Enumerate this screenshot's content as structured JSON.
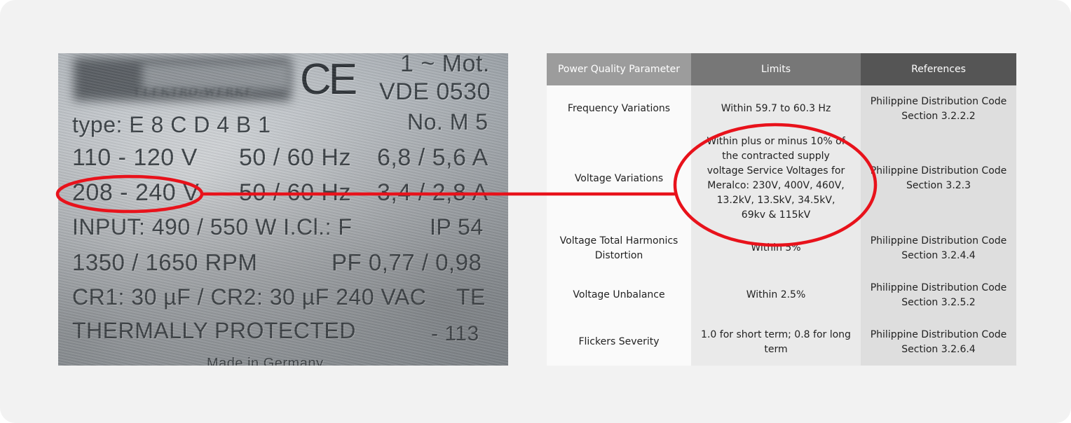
{
  "nameplate": {
    "blurred_logo_text": "ELEKTRO-WERKE",
    "ce_mark": "CE",
    "motor": "1 ~ Mot.",
    "standard": "VDE 0530",
    "number": "No. M 5",
    "type": "type: E 8 C D 4 B 1",
    "line1": {
      "voltage": "110 - 120 V",
      "freq": "50 / 60 Hz",
      "current": "6,8 / 5,6 A"
    },
    "line2": {
      "voltage": "208 - 240 V",
      "freq": "50 / 60 Hz",
      "current": "3,4 / 2,8 A"
    },
    "line3": {
      "input": "INPUT: 490 / 550 W  I.Cl.: F",
      "ip": "IP 54"
    },
    "line4": {
      "rpm": "1350 / 1650 RPM",
      "pf": "PF 0,77 / 0,98"
    },
    "line5": {
      "cap": "CR1: 30 µF / CR2: 30 µF 240 VAC",
      "te": "TE"
    },
    "line6": {
      "thermal": "THERMALLY  PROTECTED",
      "code": "- 113"
    },
    "made_in": "Made in Germany"
  },
  "table": {
    "headers": [
      "Power Quality Parameter",
      "Limits",
      "References"
    ],
    "header_colors": [
      "#9c9c9c",
      "#777777",
      "#555555"
    ],
    "rows": [
      {
        "parameter": "Frequency Variations",
        "limits": "Within 59.7 to 60.3 Hz",
        "reference": "Philippine Distribution Code Section 3.2.2.2"
      },
      {
        "parameter": "Voltage Variations",
        "limits": "Within plus or minus 10% of the contracted supply voltage Service Voltages for Meralco: 230V, 400V, 460V, 13.2kV, 13.SkV, 34.5kV, 69kv & 115kV",
        "reference": "Philippine Distribution Code Section 3.2.3"
      },
      {
        "parameter": "Voltage Total Harmonics Distortion",
        "limits": "Within 5%",
        "reference": "Philippine Distribution Code Section 3.2.4.4"
      },
      {
        "parameter": "Voltage Unbalance",
        "limits": "Within 2.5%",
        "reference": "Philippine Distribution Code Section 3.2.5.2"
      },
      {
        "parameter": "Flickers Severity",
        "limits": "1.0 for short term; 0.8 for long term",
        "reference": "Philippine Distribution Code Section 3.2.6.4"
      }
    ]
  },
  "annotation_color": "#e8121b"
}
